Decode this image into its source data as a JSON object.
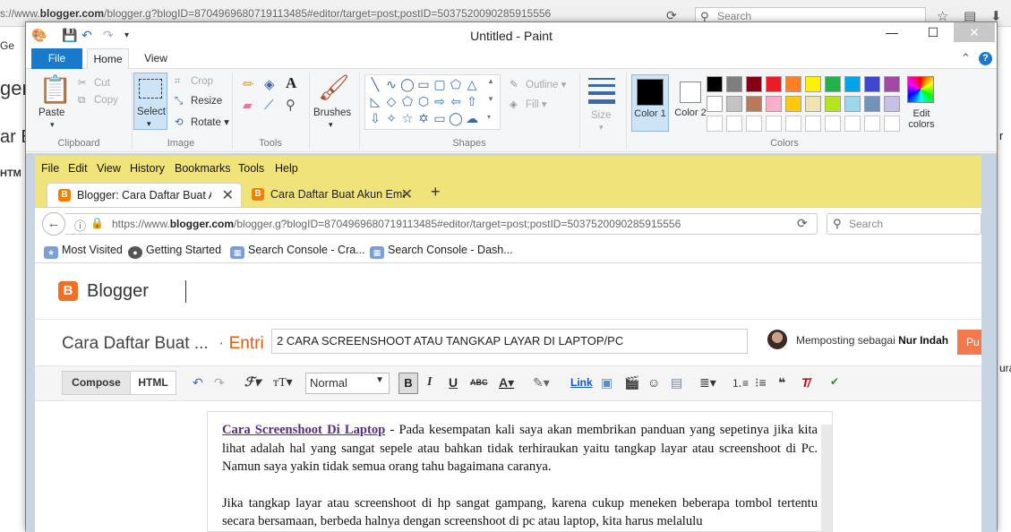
{
  "bg_browser": {
    "url_prefix": "s://www.",
    "url_domain": "blogger.com",
    "url_rest": "/blogger.g?blogID=8704969680719113485#editor/target=post;postID=5037520090285915556",
    "search_placeholder": "Search",
    "left_fragments": [
      "Ge",
      "ger",
      "ar B",
      "HTM"
    ],
    "right_fragments": [
      "r",
      "ura"
    ]
  },
  "paint": {
    "title": "Untitled - Paint",
    "tabs": [
      "File",
      "Home",
      "View"
    ],
    "clipboard": {
      "paste": "Paste",
      "cut": "Cut",
      "copy": "Copy",
      "label": "Clipboard"
    },
    "image": {
      "select": "Select",
      "crop": "Crop",
      "resize": "Resize",
      "rotate": "Rotate",
      "label": "Image"
    },
    "tools_label": "Tools",
    "brushes": "Brushes",
    "shapes": {
      "outline": "Outline",
      "fill": "Fill",
      "label": "Shapes"
    },
    "size": "Size",
    "color1": "Color 1",
    "color2": "Color 2",
    "colors_label": "Colors",
    "edit_colors": "Edit colors",
    "palette_row1": [
      "#000000",
      "#7f7f7f",
      "#880015",
      "#ed1c24",
      "#ff7f27",
      "#fff200",
      "#22b14c",
      "#00a2e8",
      "#3f48cc",
      "#a349a4"
    ],
    "palette_row2": [
      "#ffffff",
      "#c3c3c3",
      "#b97a57",
      "#ffaec9",
      "#ffc90e",
      "#efe4b0",
      "#b5e61d",
      "#99d9ea",
      "#7092be",
      "#c8bfe7"
    ]
  },
  "ff": {
    "menu": [
      "File",
      "Edit",
      "View",
      "History",
      "Bookmarks",
      "Tools",
      "Help"
    ],
    "tab1": "Blogger: Cara Daftar Buat Ak",
    "tab2": "Cara Daftar Buat Akun Email",
    "url_prefix": "https://www.",
    "url_domain": "blogger.com",
    "url_rest": "/blogger.g?blogID=8704969680719113485#editor/target=post;postID=5037520090285915556",
    "search_placeholder": "Search",
    "bookmarks": [
      "Most Visited",
      "Getting Started",
      "Search Console - Cra...",
      "Search Console - Dash..."
    ]
  },
  "blogger": {
    "brand": "Blogger",
    "blog_name": "Cara Daftar Buat ...",
    "entri": "· Entri",
    "post_title": "2 CARA SCREENSHOOT ATAU TANGKAP LAYAR DI LAPTOP/PC",
    "author_prefix": "Memposting sebagai",
    "author_name": "Nur Indah",
    "publish": "Pu",
    "compose": "Compose",
    "html": "HTML",
    "format": "Normal",
    "link": "Link",
    "para1_link": "Cara Screenshoot Di Laptop",
    "para1_text": " - Pada kesempatan kali saya akan membrikan panduan  yang sepetinya jika kita lihat adalah hal yang sangat sepele atau bahkan tidak terhiraukan yaitu tangkap layar atau screenshoot di Pc. Namun saya yakin tidak semua orang tahu bagaimana caranya.",
    "para2": "Jika tangkap layar atau screenshoot di hp sangat gampang, karena cukup meneken beberapa tombol tertentu secara bersamaan, berbeda halnya dengan screenshoot di pc atau laptop, kita harus melalulu"
  }
}
